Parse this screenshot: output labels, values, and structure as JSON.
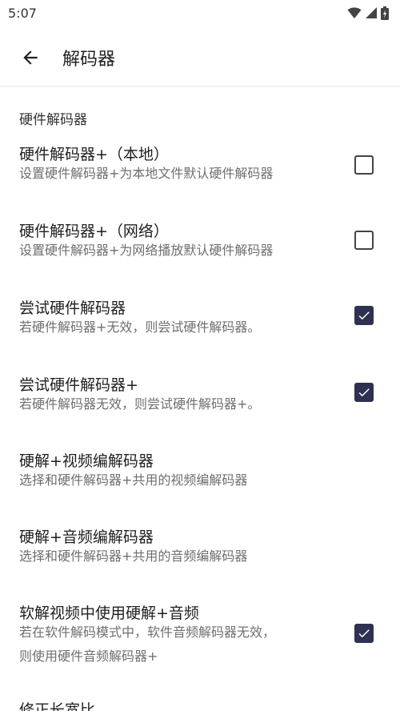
{
  "status": {
    "time": "5:07"
  },
  "header": {
    "title": "解码器"
  },
  "section": {
    "title": "硬件解码器"
  },
  "prefs": [
    {
      "title": "硬件解码器+（本地）",
      "summary": "设置硬件解码器+为本地文件默认硬件解码器",
      "checked": false
    },
    {
      "title": "硬件解码器+（网络）",
      "summary": "设置硬件解码器+为网络播放默认硬件解码器",
      "checked": false
    },
    {
      "title": "尝试硬件解码器",
      "summary": "若硬件解码器+无效，则尝试硬件解码器。",
      "checked": true
    },
    {
      "title": "尝试硬件解码器+",
      "summary": "若硬件解码器无效，则尝试硬件解码器+。",
      "checked": true
    },
    {
      "title": "硬解+视频编解码器",
      "summary": "选择和硬件解码器+共用的视频编解码器"
    },
    {
      "title": "硬解+音频编解码器",
      "summary": "选择和硬件解码器+共用的音频编解码器"
    },
    {
      "title": "软解视频中使用硬解+音频",
      "summary_line1": "若在软件解码模式中，软件音频解码器无效，",
      "summary_line2": "则使用硬件音频解码器+",
      "checked": true
    },
    {
      "title": "修正长宽比"
    }
  ],
  "colors": {
    "checkbox_checked": "#2e3150",
    "summary_text": "#6f6f6f"
  },
  "icons": {
    "back": "arrow-left-icon",
    "wifi": "wifi-icon",
    "signal": "signal-icon",
    "battery": "battery-icon",
    "check": "check-icon"
  }
}
